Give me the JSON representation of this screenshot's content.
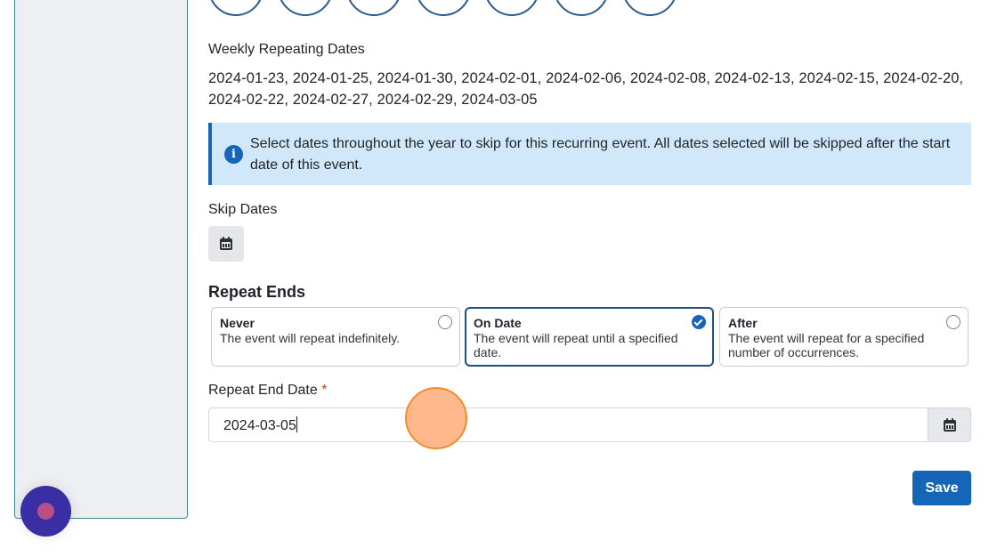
{
  "weekly": {
    "label": "Weekly Repeating Dates",
    "dates_line1": "2024-01-23, 2024-01-25, 2024-01-30, 2024-02-01, 2024-02-06, 2024-02-08, 2024-02-13, 2024-02-15, 2024-02-20,",
    "dates_line2": "2024-02-22, 2024-02-27, 2024-02-29, 2024-03-05"
  },
  "info_banner": {
    "icon": "info-icon",
    "text": "Select dates throughout the year to skip for this recurring event. All dates selected will be skipped after the start date of this event."
  },
  "skip_dates": {
    "label": "Skip Dates",
    "icon": "calendar-icon"
  },
  "repeat_ends": {
    "heading": "Repeat Ends",
    "options": [
      {
        "title": "Never",
        "description": "The event will repeat indefinitely.",
        "selected": false
      },
      {
        "title": "On Date",
        "description": "The event will repeat until a specified date.",
        "selected": true
      },
      {
        "title": "After",
        "description": "The event will repeat for a specified number of occurrences.",
        "selected": false
      }
    ]
  },
  "repeat_end_date": {
    "label": "Repeat End Date",
    "required_marker": "*",
    "value": "2024-03-05"
  },
  "actions": {
    "save_label": "Save"
  },
  "colors": {
    "primary": "#1565b8",
    "info_background": "#d1e8fb",
    "required": "#c2431c",
    "help_fab": "#3a2ea5"
  }
}
